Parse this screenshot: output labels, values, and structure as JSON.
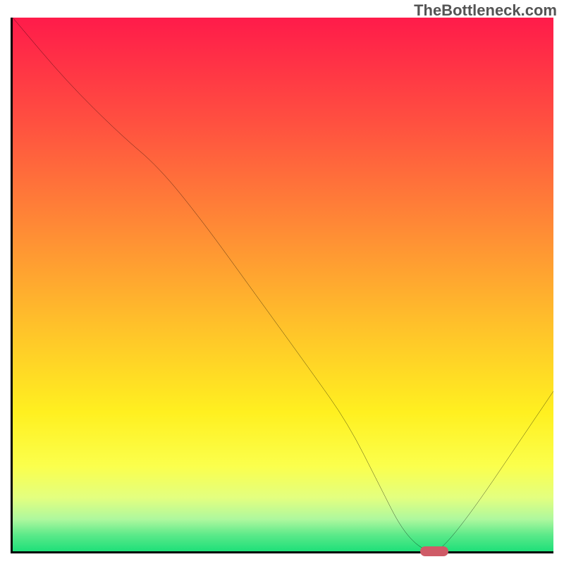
{
  "watermark": "TheBottleneck.com",
  "chart_data": {
    "type": "line",
    "title": "",
    "xlabel": "",
    "ylabel": "",
    "xlim": [
      0,
      100
    ],
    "ylim": [
      0,
      100
    ],
    "grid": false,
    "legend": false,
    "background": {
      "type": "vertical-gradient",
      "stops": [
        {
          "pos": 0.0,
          "color": "#ff1b4a"
        },
        {
          "pos": 0.2,
          "color": "#ff5140"
        },
        {
          "pos": 0.4,
          "color": "#ff8c35"
        },
        {
          "pos": 0.58,
          "color": "#ffc22a"
        },
        {
          "pos": 0.74,
          "color": "#fff020"
        },
        {
          "pos": 0.84,
          "color": "#fbff4c"
        },
        {
          "pos": 0.9,
          "color": "#e3ff80"
        },
        {
          "pos": 0.94,
          "color": "#aef89e"
        },
        {
          "pos": 0.97,
          "color": "#5ae989"
        },
        {
          "pos": 1.0,
          "color": "#1ee079"
        }
      ]
    },
    "series": [
      {
        "name": "bottleneck-curve",
        "color": "#000000",
        "x": [
          0,
          10,
          20,
          27,
          35,
          45,
          55,
          62,
          68,
          72,
          76,
          80,
          100
        ],
        "y": [
          100,
          88,
          78,
          72,
          62,
          48,
          34,
          24,
          12,
          4,
          0,
          0,
          30
        ]
      }
    ],
    "marker": {
      "name": "optimal-point",
      "x": 78,
      "y": 0,
      "color": "#cf5b67"
    }
  }
}
